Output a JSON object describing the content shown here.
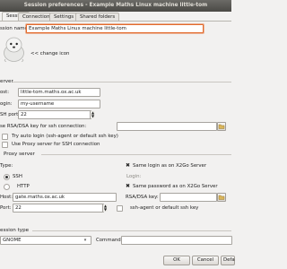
{
  "window": {
    "title": "Session preferences - Example Maths Linux machine little-tom"
  },
  "tabs": [
    {
      "label": "Session"
    },
    {
      "label": "Connection"
    },
    {
      "label": "Settings"
    },
    {
      "label": "Shared folders"
    }
  ],
  "session": {
    "name_label": "ssion name:",
    "name_value": "Example Maths Linux machine little-tom",
    "change_icon_label": "<< change icon"
  },
  "server": {
    "section_title": "erver",
    "host_label": "ost:",
    "host_value": "little-tom.maths.ox.ac.uk",
    "login_label": "ogin:",
    "login_value": "my-username",
    "ssh_port_label": "SH port:",
    "ssh_port_value": "22",
    "rsa_label": "se RSA/DSA key for ssh connection:",
    "auto_login_label": "Try auto login (ssh-agent or default ssh key)",
    "proxy_label": "Use Proxy server for SSH connection"
  },
  "proxy": {
    "section_title": "Proxy server",
    "type_label": "Type:",
    "same_login_label": "Same login as on X2Go Server",
    "ssh_label": "SSH",
    "login_label": "Login:",
    "http_label": "HTTP",
    "same_password_label": "Same password as on X2Go Server",
    "host_label": "Host:",
    "host_value": "gate.maths.ox.ac.uk",
    "rsa_label": "RSA/DSA key:",
    "port_label": "Port:",
    "port_value": "22",
    "agent_label": "ssh-agent or default ssh key"
  },
  "session_type": {
    "section_title": "ession type",
    "type_value": "GNOME",
    "command_label": "Command:"
  },
  "buttons": {
    "ok": "OK",
    "cancel": "Cancel",
    "defaults": "Defa"
  }
}
